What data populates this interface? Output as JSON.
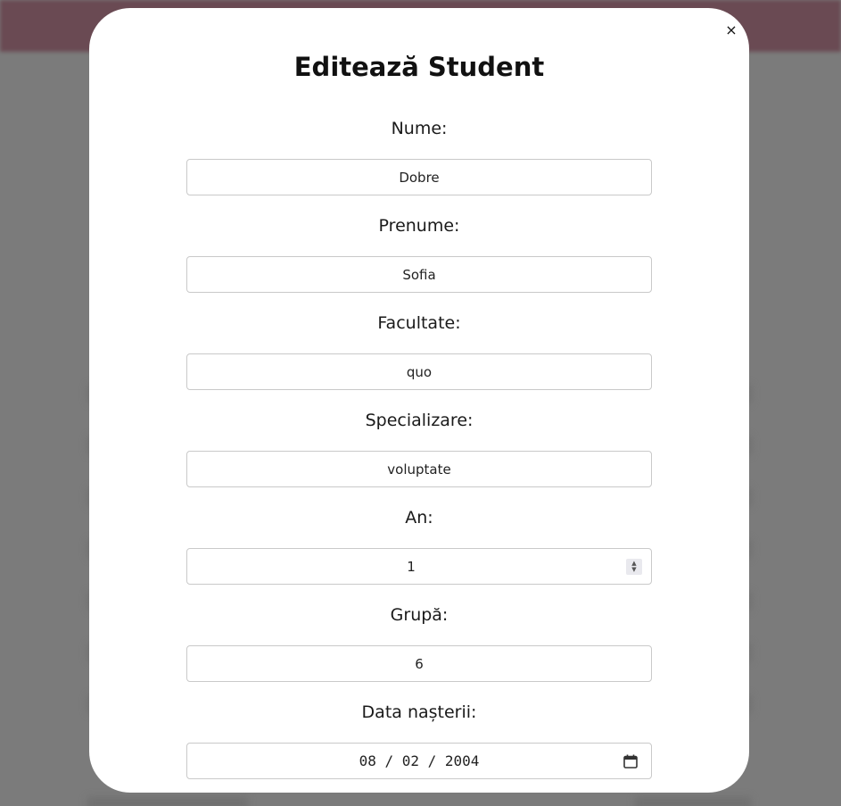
{
  "modal": {
    "title": "Editează Student",
    "close_label": "×"
  },
  "fields": [
    {
      "label": "Nume:",
      "value": "Dobre"
    },
    {
      "label": "Prenume:",
      "value": "Sofia"
    },
    {
      "label": "Facultate:",
      "value": "quo"
    },
    {
      "label": "Specializare:",
      "value": "voluptate"
    },
    {
      "label": "An:",
      "value": "1"
    },
    {
      "label": "Grupă:",
      "value": "6"
    },
    {
      "label": "Data nașterii:",
      "value": "08 / 02 / 2004"
    }
  ],
  "icons": {
    "stepper": "number-stepper-icon",
    "date_picker": "calendar-icon"
  },
  "colors": {
    "overlay": "#7b7b7b",
    "header_bar": "#6a4a53",
    "modal_bg": "#ffffff",
    "input_border": "#c9c9c9"
  }
}
